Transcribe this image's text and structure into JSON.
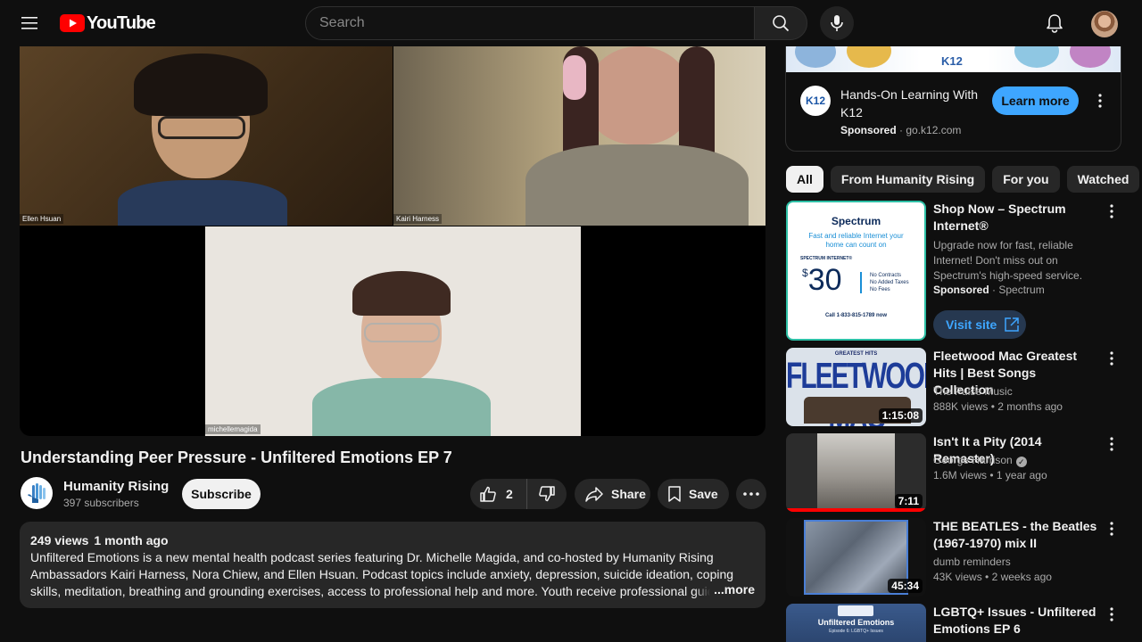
{
  "header": {
    "logo_text": "YouTube",
    "search_placeholder": "Search"
  },
  "video": {
    "participants": [
      "Ellen Hsuan",
      "Kairi Harness",
      "michellemagida"
    ],
    "title": "Understanding Peer Pressure - Unfiltered Emotions EP 7",
    "channel_name": "Humanity Rising",
    "subscribers": "397 subscribers",
    "subscribe_label": "Subscribe",
    "likes": "2",
    "share_label": "Share",
    "save_label": "Save",
    "views": "249 views",
    "posted": "1 month ago",
    "description": "Unfiltered Emotions is a new mental health podcast series featuring Dr. Michelle Magida, and co-hosted by Humanity Rising Ambassadors Kairi Harness, Nora Chiew, and Ellen Hsuan. Podcast topics include anxiety, depression, suicide ideation, coping skills, meditation, breathing and grounding exercises, access to professional help and more. Youth receive professional guidance and also share their challenges",
    "more_label": "...more"
  },
  "ad": {
    "banner_text": "K12",
    "logo_text": "K12",
    "title": "Hands-On Learning With K12",
    "sponsored": "Sponsored",
    "domain": "go.k12.com",
    "cta": "Learn more"
  },
  "chips": [
    "All",
    "From Humanity Rising",
    "For you",
    "Watched"
  ],
  "recommendations": [
    {
      "title": "Shop Now – Spectrum Internet®",
      "description": "Upgrade now for fast, reliable Internet! Don't miss out on Spectrum's high-speed service.",
      "sponsored": "Sponsored",
      "advertiser": "Spectrum",
      "cta": "Visit site",
      "thumb": {
        "brand": "Spectrum",
        "tagline": "Fast and reliable Internet your home can count on",
        "product": "SPECTRUM INTERNET®",
        "price": "30",
        "currency": "$",
        "bullets": [
          "No Contracts",
          "No Added Taxes",
          "No Fees"
        ],
        "phone": "Call 1-833-815-1789 now"
      }
    },
    {
      "title": "Fleetwood Mac Greatest Hits | Best Songs Collection",
      "channel": "The Pulse Music",
      "views": "888K views",
      "age": "2 months ago",
      "duration": "1:15:08",
      "thumb_text": "FLEETWOOD MAC",
      "thumb_top": "GREATEST HITS"
    },
    {
      "title": "Isn't It a Pity (2014 Remaster)",
      "channel": "George Harrison",
      "views": "1.6M views",
      "age": "1 year ago",
      "duration": "7:11",
      "progress": 1.0
    },
    {
      "title": "THE BEATLES - the Beatles (1967-1970) mix II",
      "channel": "dumb reminders",
      "views": "43K views",
      "age": "2 weeks ago",
      "duration": "45:34"
    },
    {
      "title": "LGBTQ+ Issues - Unfiltered Emotions EP 6",
      "thumb_text": "Unfiltered Emotions",
      "thumb_sub": "Episode 6: LGBTQ+ Issues"
    }
  ],
  "colors": {
    "background": "#0f0f0f",
    "accent_red": "#ff0000",
    "learn_more_blue": "#3ea6ff"
  }
}
